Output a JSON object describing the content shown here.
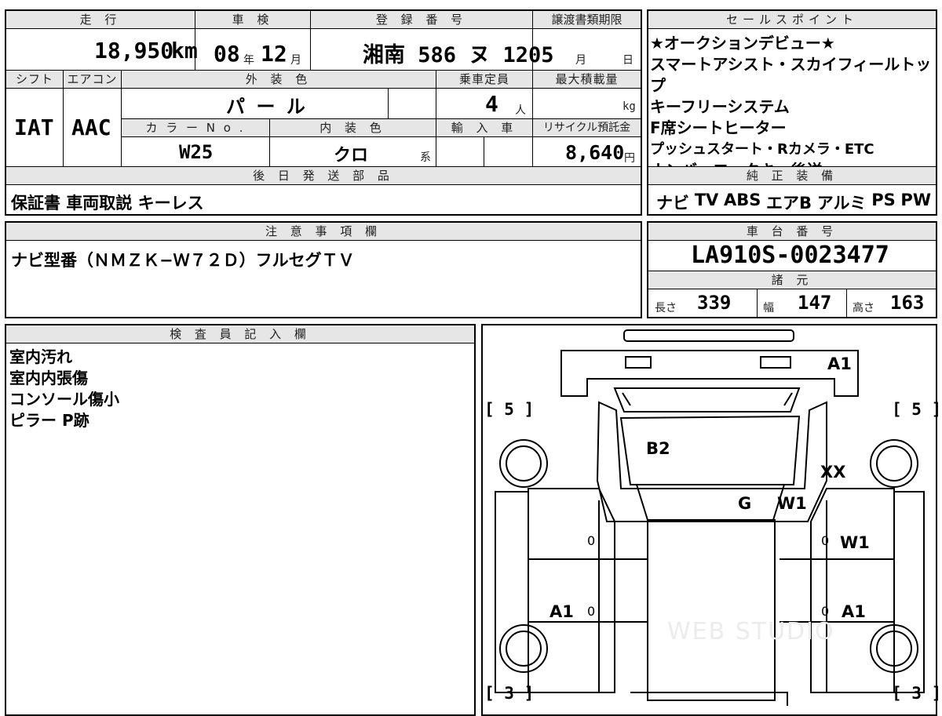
{
  "headers": {
    "mileage": "走 行",
    "inspection": "車 検",
    "registration": "登 録 番 号",
    "transfer_deadline": "譲渡書類期限",
    "sales_point": "セールスポイント",
    "shift": "シフト",
    "aircon": "エアコン",
    "exterior_color": "外 装 色",
    "capacity": "乗車定員",
    "max_load": "最大積載量",
    "color_no": "カ ラ ー N o .",
    "interior_color": "内 装 色",
    "import": "輸 入 車",
    "recycle_fee": "リサイクル預託金",
    "later_parts": "後 日 発 送 部 品",
    "genuine_equipment": "純 正 装 備",
    "notes": "注 意 事 項 欄",
    "chassis_no": "車 台 番 号",
    "specs": "諸 元",
    "inspector": "検 査 員 記 入 欄"
  },
  "vehicle": {
    "mileage_value": "18,950",
    "mileage_unit": "km",
    "inspection_year": "08",
    "year_unit": "年",
    "inspection_month": "12",
    "month_unit": "月",
    "registration_number": "湘南 586 ヌ 1205",
    "transfer_month": "月",
    "transfer_day": "日",
    "shift_value": "IAT",
    "aircon_value": "AAC",
    "exterior_color_value": "パ ー ル",
    "capacity_value": "4",
    "capacity_unit": "人",
    "max_load_unit": "kg",
    "color_no_value": "W25",
    "interior_color_value": "クロ",
    "interior_suffix": "系",
    "recycle_fee_value": "8,640",
    "recycle_fee_unit": "円",
    "chassis_number": "LA910S-0023477",
    "length_label": "長さ",
    "length_value": "339",
    "width_label": "幅",
    "width_value": "147",
    "height_label": "高さ",
    "height_value": "163"
  },
  "sales_points": [
    "★オークションデビュー★",
    "スマートアシスト・スカイフィールトップ",
    "キーフリーシステム",
    "F席シートヒーター",
    "プッシュスタート・Rカメラ・ETC",
    "ナンバーロックキー後送"
  ],
  "later_parts_items": "保証書 車両取説 キーレス",
  "genuine_equipment_items": [
    "ナビ",
    "TV",
    "ABS",
    "エアB",
    "アルミ",
    "PS",
    "PW"
  ],
  "notes_text": "ナビ型番（ＮＭＺＫ−Ｗ７２Ｄ）フルセグＴＶ",
  "inspector_notes": [
    "室内汚れ",
    "室内内張傷",
    "コンソール傷小",
    "ピラー P跡"
  ],
  "diagram": {
    "tire_tl": "[ 5 ]",
    "tire_tr": "[ 5 ]",
    "tire_bl": "[ 3 ]",
    "tire_br": "[ 3 ]",
    "marks": {
      "a1_rear": "A1",
      "b2_windshield": "B2",
      "xx_fender": "XX",
      "g_pillar": "G",
      "w1_pillar": "W1",
      "w1_door": "W1",
      "a1_left": "A1",
      "a1_right": "A1",
      "zero": "0"
    },
    "watermark": "WEB STUDIO"
  }
}
